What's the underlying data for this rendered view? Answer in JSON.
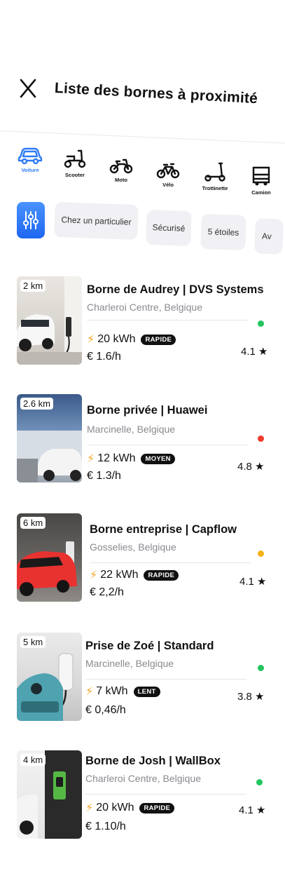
{
  "header": {
    "title": "Liste des bornes à proximité"
  },
  "vehicles": [
    {
      "label": "Voiture",
      "icon": "car-icon",
      "active": true
    },
    {
      "label": "Scooter",
      "icon": "scooter-icon"
    },
    {
      "label": "Moto",
      "icon": "motorcycle-icon"
    },
    {
      "label": "Vélo",
      "icon": "bicycle-icon"
    },
    {
      "label": "Trottinette",
      "icon": "kick-scooter-icon"
    },
    {
      "label": "Camion",
      "icon": "truck-icon"
    }
  ],
  "filters": [
    "Chez un particulier",
    "Sécurisé",
    "5 étoiles",
    "Av"
  ],
  "colors": {
    "accent": "#2e7bf6",
    "green": "#22c55e",
    "red": "#ef3b2c",
    "orange": "#f5b216",
    "bolt": "#f5a623"
  },
  "stations": [
    {
      "distance": "2 km",
      "name": "Borne de Audrey | DVS Systems",
      "location": "Charleroi Centre, Belgique",
      "power": "20 kWh",
      "speed": "RAPIDE",
      "price": "€ 1.6/h",
      "rating": "4.1",
      "status_color": "#22c55e"
    },
    {
      "distance": "2.6 km",
      "name": "Borne privée | Huawei",
      "location": "Marcinelle, Belgique",
      "power": "12 kWh",
      "speed": "MOYEN",
      "price": "€ 1.3/h",
      "rating": "4.8",
      "status_color": "#ef3b2c"
    },
    {
      "distance": "6 km",
      "name": "Borne entreprise | Capflow",
      "location": "Gosselies, Belgique",
      "power": "22 kWh",
      "speed": "RAPIDE",
      "price": "€ 2,2/h",
      "rating": "4.1",
      "status_color": "#f5b216"
    },
    {
      "distance": "5 km",
      "name": "Prise de Zoé | Standard",
      "location": "Marcinelle, Belgique",
      "power": "7 kWh",
      "speed": "LENT",
      "price": "€ 0,46/h",
      "rating": "3.8",
      "status_color": "#22c55e"
    },
    {
      "distance": "4 km",
      "name": "Borne de Josh | WallBox",
      "location": "Charleroi Centre, Belgique",
      "power": "20 kWh",
      "speed": "RAPIDE",
      "price": "€ 1.10/h",
      "rating": "4.1",
      "status_color": "#22c55e"
    }
  ]
}
